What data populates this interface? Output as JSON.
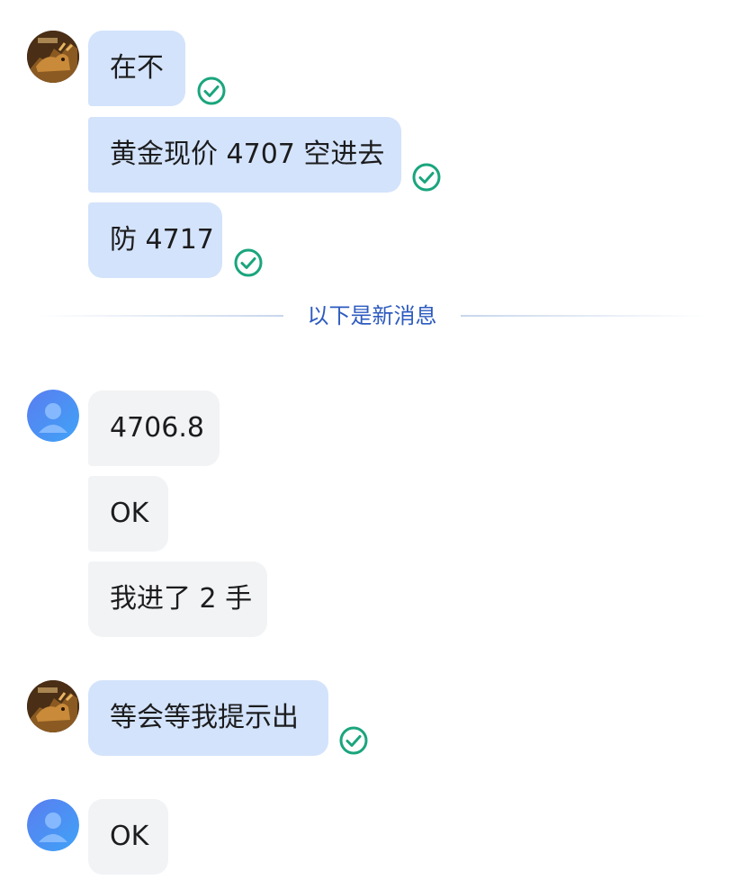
{
  "messages": [
    {
      "sender": "bull-avatar",
      "text": "在不",
      "read": true
    },
    {
      "sender": "bull-avatar",
      "text": "黄金现价 4707 空进去",
      "read": true
    },
    {
      "sender": "bull-avatar",
      "text": "防 4717",
      "read": true
    },
    {
      "sender": "user-avatar",
      "text": "4706.8"
    },
    {
      "sender": "user-avatar",
      "text": "OK"
    },
    {
      "sender": "user-avatar",
      "text": "我进了 2 手"
    },
    {
      "sender": "bull-avatar",
      "text": "等会等我提示出",
      "read": true
    },
    {
      "sender": "user-avatar",
      "text": "OK"
    }
  ],
  "new_messages_divider": "以下是新消息",
  "icons": {
    "read_receipt": "check-circle-icon",
    "bull_avatar": "bull-avatar",
    "user_avatar": "user-avatar"
  },
  "colors": {
    "outgoing_bubble": "#d3e3fb",
    "incoming_bubble": "#f2f3f5",
    "read_check": "#1aa57d",
    "divider_text": "#2d5bbf"
  }
}
